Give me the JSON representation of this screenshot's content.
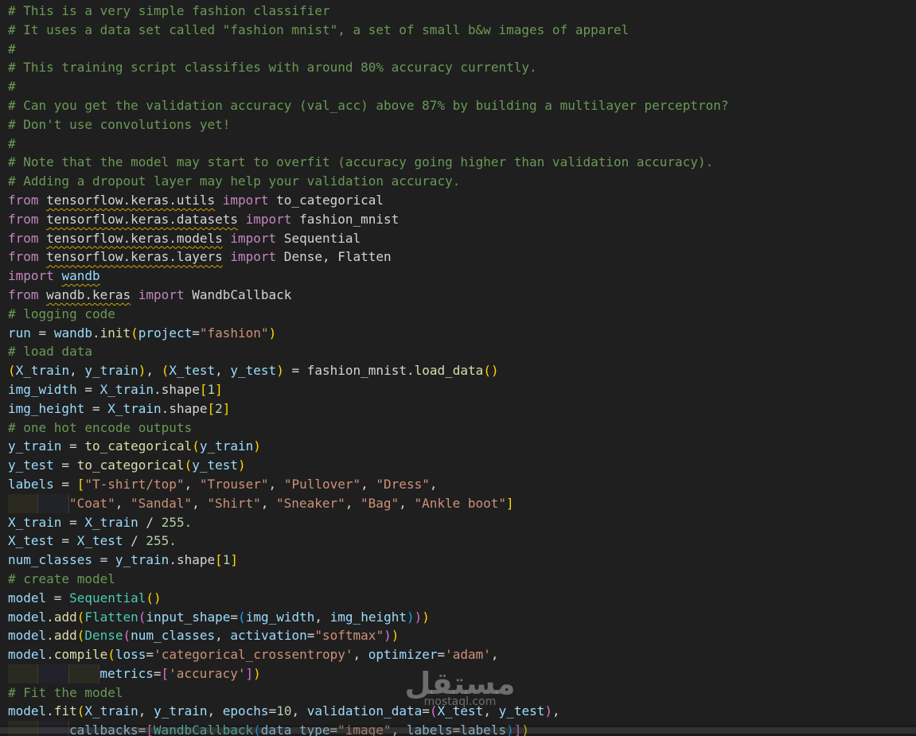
{
  "editor": {
    "watermark": {
      "text": "مستقل",
      "sub": "mostaql.com"
    },
    "lines": [
      [
        {
          "t": "comment",
          "v": "# This is a very simple fashion classifier"
        }
      ],
      [
        {
          "t": "comment",
          "v": "# It uses a data set called \"fashion mnist\", a set of small b&w images of apparel"
        }
      ],
      [
        {
          "t": "comment",
          "v": "#"
        }
      ],
      [
        {
          "t": "comment",
          "v": "# This training script classifies with around 80% accuracy currently."
        }
      ],
      [
        {
          "t": "comment",
          "v": "#"
        }
      ],
      [
        {
          "t": "comment",
          "v": "# Can you get the validation accuracy (val_acc) above 87% by building a multilayer perceptron?"
        }
      ],
      [
        {
          "t": "comment",
          "v": "# Don't use convolutions yet!"
        }
      ],
      [
        {
          "t": "comment",
          "v": "#"
        }
      ],
      [
        {
          "t": "comment",
          "v": "# Note that the model may start to overfit (accuracy going higher than validation accuracy)."
        }
      ],
      [
        {
          "t": "comment",
          "v": "# Adding a dropout layer may help your validation accuracy."
        }
      ],
      [
        {
          "t": "keyword",
          "v": "from"
        },
        {
          "t": "plain",
          "v": " "
        },
        {
          "t": "module",
          "v": "tensorflow.keras.utils"
        },
        {
          "t": "plain",
          "v": " "
        },
        {
          "t": "keyword",
          "v": "import"
        },
        {
          "t": "plain",
          "v": " to_categorical"
        }
      ],
      [
        {
          "t": "keyword",
          "v": "from"
        },
        {
          "t": "plain",
          "v": " "
        },
        {
          "t": "module",
          "v": "tensorflow.keras.datasets"
        },
        {
          "t": "plain",
          "v": " "
        },
        {
          "t": "keyword",
          "v": "import"
        },
        {
          "t": "plain",
          "v": " fashion_mnist"
        }
      ],
      [
        {
          "t": "keyword",
          "v": "from"
        },
        {
          "t": "plain",
          "v": " "
        },
        {
          "t": "module",
          "v": "tensorflow.keras.models"
        },
        {
          "t": "plain",
          "v": " "
        },
        {
          "t": "keyword",
          "v": "import"
        },
        {
          "t": "plain",
          "v": " Sequential"
        }
      ],
      [
        {
          "t": "keyword",
          "v": "from"
        },
        {
          "t": "plain",
          "v": " "
        },
        {
          "t": "module",
          "v": "tensorflow.keras.layers"
        },
        {
          "t": "plain",
          "v": " "
        },
        {
          "t": "keyword",
          "v": "import"
        },
        {
          "t": "plain",
          "v": " Dense, Flatten"
        }
      ],
      [
        {
          "t": "keyword",
          "v": "import"
        },
        {
          "t": "plain",
          "v": " "
        },
        {
          "t": "module-var",
          "v": "wandb"
        }
      ],
      [
        {
          "t": "keyword",
          "v": "from"
        },
        {
          "t": "plain",
          "v": " "
        },
        {
          "t": "module",
          "v": "wandb.keras"
        },
        {
          "t": "plain",
          "v": " "
        },
        {
          "t": "keyword",
          "v": "import"
        },
        {
          "t": "plain",
          "v": " WandbCallback"
        }
      ],
      [
        {
          "t": "comment",
          "v": "# logging code"
        }
      ],
      [
        {
          "t": "var",
          "v": "run"
        },
        {
          "t": "op",
          "v": " = "
        },
        {
          "t": "var",
          "v": "wandb"
        },
        {
          "t": "op",
          "v": "."
        },
        {
          "t": "func",
          "v": "init"
        },
        {
          "t": "bracket1",
          "v": "("
        },
        {
          "t": "param",
          "v": "project"
        },
        {
          "t": "op",
          "v": "="
        },
        {
          "t": "string",
          "v": "\"fashion\""
        },
        {
          "t": "bracket1",
          "v": ")"
        }
      ],
      [
        {
          "t": "comment",
          "v": "# load data"
        }
      ],
      [
        {
          "t": "bracket1",
          "v": "("
        },
        {
          "t": "var",
          "v": "X_train"
        },
        {
          "t": "op",
          "v": ", "
        },
        {
          "t": "var",
          "v": "y_train"
        },
        {
          "t": "bracket1",
          "v": ")"
        },
        {
          "t": "op",
          "v": ", "
        },
        {
          "t": "bracket1",
          "v": "("
        },
        {
          "t": "var",
          "v": "X_test"
        },
        {
          "t": "op",
          "v": ", "
        },
        {
          "t": "var",
          "v": "y_test"
        },
        {
          "t": "bracket1",
          "v": ")"
        },
        {
          "t": "op",
          "v": " = "
        },
        {
          "t": "plain",
          "v": "fashion_mnist"
        },
        {
          "t": "op",
          "v": "."
        },
        {
          "t": "func",
          "v": "load_data"
        },
        {
          "t": "bracket1",
          "v": "()"
        }
      ],
      [
        {
          "t": "var",
          "v": "img_width"
        },
        {
          "t": "op",
          "v": " = "
        },
        {
          "t": "var",
          "v": "X_train"
        },
        {
          "t": "op",
          "v": "."
        },
        {
          "t": "plain",
          "v": "shape"
        },
        {
          "t": "bracket1",
          "v": "["
        },
        {
          "t": "number",
          "v": "1"
        },
        {
          "t": "bracket1",
          "v": "]"
        }
      ],
      [
        {
          "t": "var",
          "v": "img_height"
        },
        {
          "t": "op",
          "v": " = "
        },
        {
          "t": "var",
          "v": "X_train"
        },
        {
          "t": "op",
          "v": "."
        },
        {
          "t": "plain",
          "v": "shape"
        },
        {
          "t": "bracket1",
          "v": "["
        },
        {
          "t": "number",
          "v": "2"
        },
        {
          "t": "bracket1",
          "v": "]"
        }
      ],
      [
        {
          "t": "comment",
          "v": "# one hot encode outputs"
        }
      ],
      [
        {
          "t": "var",
          "v": "y_train"
        },
        {
          "t": "op",
          "v": " = "
        },
        {
          "t": "func",
          "v": "to_categorical"
        },
        {
          "t": "bracket1",
          "v": "("
        },
        {
          "t": "var",
          "v": "y_train"
        },
        {
          "t": "bracket1",
          "v": ")"
        }
      ],
      [
        {
          "t": "var",
          "v": "y_test"
        },
        {
          "t": "op",
          "v": " = "
        },
        {
          "t": "func",
          "v": "to_categorical"
        },
        {
          "t": "bracket1",
          "v": "("
        },
        {
          "t": "var",
          "v": "y_test"
        },
        {
          "t": "bracket1",
          "v": ")"
        }
      ],
      [
        {
          "t": "var",
          "v": "labels"
        },
        {
          "t": "op",
          "v": " = "
        },
        {
          "t": "bracket1",
          "v": "["
        },
        {
          "t": "string",
          "v": "\"T-shirt/top\""
        },
        {
          "t": "op",
          "v": ", "
        },
        {
          "t": "string",
          "v": "\"Trouser\""
        },
        {
          "t": "op",
          "v": ", "
        },
        {
          "t": "string",
          "v": "\"Pullover\""
        },
        {
          "t": "op",
          "v": ", "
        },
        {
          "t": "string",
          "v": "\"Dress\""
        },
        {
          "t": "op",
          "v": ","
        }
      ],
      [
        {
          "t": "indent",
          "v": "2"
        },
        {
          "t": "string",
          "v": "\"Coat\""
        },
        {
          "t": "op",
          "v": ", "
        },
        {
          "t": "string",
          "v": "\"Sandal\""
        },
        {
          "t": "op",
          "v": ", "
        },
        {
          "t": "string",
          "v": "\"Shirt\""
        },
        {
          "t": "op",
          "v": ", "
        },
        {
          "t": "string",
          "v": "\"Sneaker\""
        },
        {
          "t": "op",
          "v": ", "
        },
        {
          "t": "string",
          "v": "\"Bag\""
        },
        {
          "t": "op",
          "v": ", "
        },
        {
          "t": "string",
          "v": "\"Ankle boot\""
        },
        {
          "t": "bracket1",
          "v": "]"
        }
      ],
      [
        {
          "t": "var",
          "v": "X_train"
        },
        {
          "t": "op",
          "v": " = "
        },
        {
          "t": "var",
          "v": "X_train"
        },
        {
          "t": "op",
          "v": " / "
        },
        {
          "t": "number",
          "v": "255."
        }
      ],
      [
        {
          "t": "var",
          "v": "X_test"
        },
        {
          "t": "op",
          "v": " = "
        },
        {
          "t": "var",
          "v": "X_test"
        },
        {
          "t": "op",
          "v": " / "
        },
        {
          "t": "number",
          "v": "255."
        }
      ],
      [
        {
          "t": "var",
          "v": "num_classes"
        },
        {
          "t": "op",
          "v": " = "
        },
        {
          "t": "var",
          "v": "y_train"
        },
        {
          "t": "op",
          "v": "."
        },
        {
          "t": "plain",
          "v": "shape"
        },
        {
          "t": "bracket1",
          "v": "["
        },
        {
          "t": "number",
          "v": "1"
        },
        {
          "t": "bracket1",
          "v": "]"
        }
      ],
      [
        {
          "t": "comment",
          "v": "# create model"
        }
      ],
      [
        {
          "t": "var",
          "v": "model"
        },
        {
          "t": "op",
          "v": " = "
        },
        {
          "t": "cls",
          "v": "Sequential"
        },
        {
          "t": "bracket1",
          "v": "()"
        }
      ],
      [
        {
          "t": "var",
          "v": "model"
        },
        {
          "t": "op",
          "v": "."
        },
        {
          "t": "func",
          "v": "add"
        },
        {
          "t": "bracket1",
          "v": "("
        },
        {
          "t": "cls",
          "v": "Flatten"
        },
        {
          "t": "bracket2",
          "v": "("
        },
        {
          "t": "param",
          "v": "input_shape"
        },
        {
          "t": "op",
          "v": "="
        },
        {
          "t": "bracket3",
          "v": "("
        },
        {
          "t": "var",
          "v": "img_width"
        },
        {
          "t": "op",
          "v": ", "
        },
        {
          "t": "var",
          "v": "img_height"
        },
        {
          "t": "bracket3",
          "v": ")"
        },
        {
          "t": "bracket2",
          "v": ")"
        },
        {
          "t": "bracket1",
          "v": ")"
        }
      ],
      [
        {
          "t": "var",
          "v": "model"
        },
        {
          "t": "op",
          "v": "."
        },
        {
          "t": "func",
          "v": "add"
        },
        {
          "t": "bracket1",
          "v": "("
        },
        {
          "t": "cls",
          "v": "Dense"
        },
        {
          "t": "bracket2",
          "v": "("
        },
        {
          "t": "var",
          "v": "num_classes"
        },
        {
          "t": "op",
          "v": ", "
        },
        {
          "t": "param",
          "v": "activation"
        },
        {
          "t": "op",
          "v": "="
        },
        {
          "t": "string",
          "v": "\"softmax\""
        },
        {
          "t": "bracket2",
          "v": ")"
        },
        {
          "t": "bracket1",
          "v": ")"
        }
      ],
      [
        {
          "t": "var",
          "v": "model"
        },
        {
          "t": "op",
          "v": "."
        },
        {
          "t": "func",
          "v": "compile"
        },
        {
          "t": "bracket1",
          "v": "("
        },
        {
          "t": "param",
          "v": "loss"
        },
        {
          "t": "op",
          "v": "="
        },
        {
          "t": "string",
          "v": "'categorical_crossentropy'"
        },
        {
          "t": "op",
          "v": ", "
        },
        {
          "t": "param",
          "v": "optimizer"
        },
        {
          "t": "op",
          "v": "="
        },
        {
          "t": "string",
          "v": "'adam'"
        },
        {
          "t": "op",
          "v": ","
        }
      ],
      [
        {
          "t": "indent",
          "v": "3"
        },
        {
          "t": "param",
          "v": "metrics"
        },
        {
          "t": "op",
          "v": "="
        },
        {
          "t": "bracket2",
          "v": "["
        },
        {
          "t": "string",
          "v": "'accuracy'"
        },
        {
          "t": "bracket2",
          "v": "]"
        },
        {
          "t": "bracket1",
          "v": ")"
        }
      ],
      [
        {
          "t": "comment",
          "v": "# Fit the model"
        }
      ],
      [
        {
          "t": "var",
          "v": "model"
        },
        {
          "t": "op",
          "v": "."
        },
        {
          "t": "func",
          "v": "fit"
        },
        {
          "t": "bracket1",
          "v": "("
        },
        {
          "t": "var",
          "v": "X_train"
        },
        {
          "t": "op",
          "v": ", "
        },
        {
          "t": "var",
          "v": "y_train"
        },
        {
          "t": "op",
          "v": ", "
        },
        {
          "t": "param",
          "v": "epochs"
        },
        {
          "t": "op",
          "v": "="
        },
        {
          "t": "number",
          "v": "10"
        },
        {
          "t": "op",
          "v": ", "
        },
        {
          "t": "param",
          "v": "validation_data"
        },
        {
          "t": "op",
          "v": "="
        },
        {
          "t": "bracket2",
          "v": "("
        },
        {
          "t": "var",
          "v": "X_test"
        },
        {
          "t": "op",
          "v": ", "
        },
        {
          "t": "var",
          "v": "y_test"
        },
        {
          "t": "bracket2",
          "v": ")"
        },
        {
          "t": "op",
          "v": ","
        }
      ],
      [
        {
          "t": "indent",
          "v": "2"
        },
        {
          "t": "param",
          "v": "callbacks"
        },
        {
          "t": "op",
          "v": "="
        },
        {
          "t": "bracket2",
          "v": "["
        },
        {
          "t": "cls",
          "v": "WandbCallback"
        },
        {
          "t": "bracket3",
          "v": "("
        },
        {
          "t": "param",
          "v": "data_type"
        },
        {
          "t": "op",
          "v": "="
        },
        {
          "t": "string",
          "v": "\"image\""
        },
        {
          "t": "op",
          "v": ", "
        },
        {
          "t": "param",
          "v": "labels"
        },
        {
          "t": "op",
          "v": "="
        },
        {
          "t": "var",
          "v": "labels"
        },
        {
          "t": "bracket3",
          "v": ")"
        },
        {
          "t": "bracket2",
          "v": "]"
        },
        {
          "t": "bracket1",
          "v": ")"
        }
      ]
    ]
  }
}
